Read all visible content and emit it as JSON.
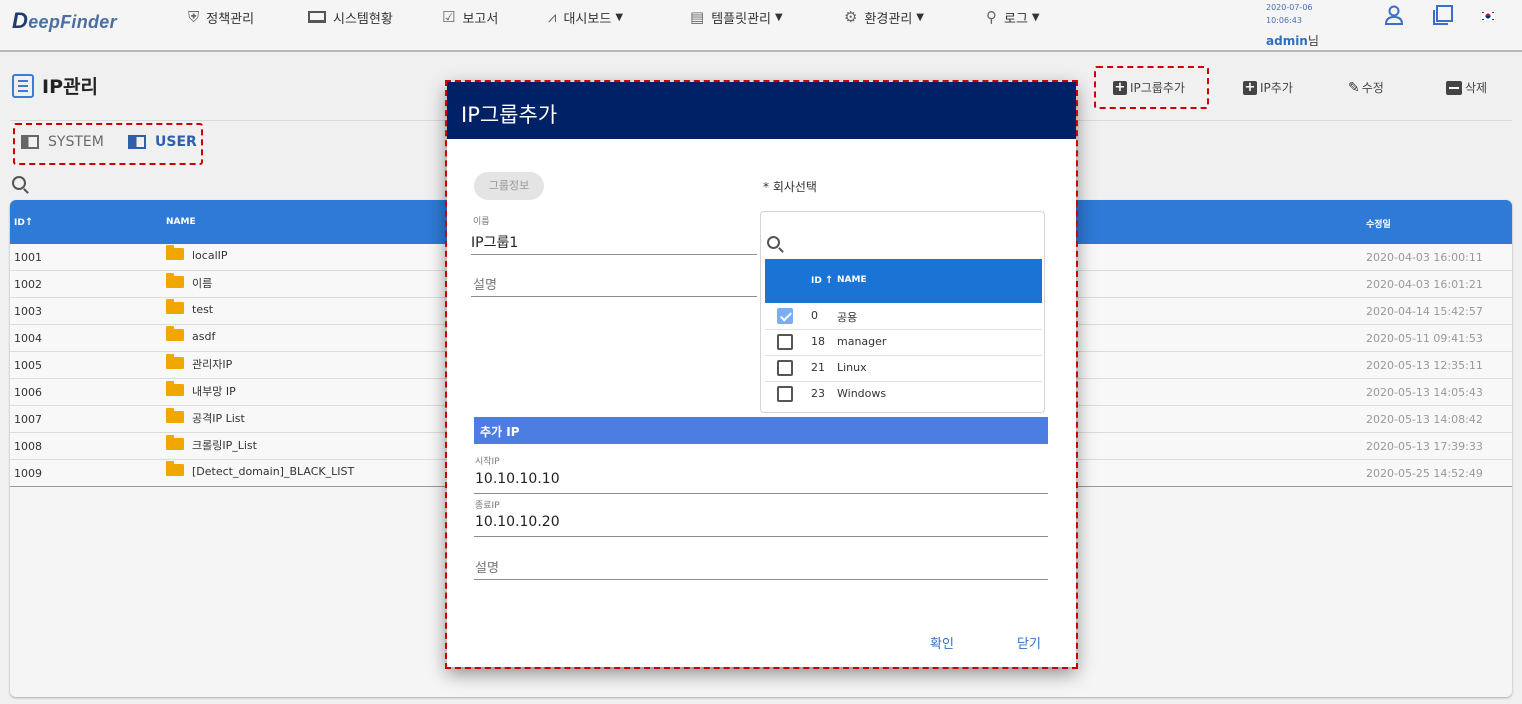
{
  "topbar": {
    "logo_first": "D",
    "logo_rest": "eepFinder",
    "nav": [
      {
        "label": "정책관리",
        "icon": "shield-icon",
        "caret": false
      },
      {
        "label": "시스템현황",
        "icon": "monitor-icon",
        "caret": false
      },
      {
        "label": "보고서",
        "icon": "clipboard-check-icon",
        "caret": false
      },
      {
        "label": "대시보드",
        "icon": "chart-line-icon",
        "caret": true
      },
      {
        "label": "템플릿관리",
        "icon": "template-icon",
        "caret": true
      },
      {
        "label": "환경관리",
        "icon": "gear-icon",
        "caret": true
      },
      {
        "label": "로그",
        "icon": "search-icon",
        "caret": true
      }
    ],
    "date": "2020-07-06",
    "time": "10:06:43",
    "user": "admin",
    "user_suffix": "님"
  },
  "page": {
    "title": "IP관리",
    "actions": {
      "add_group": "IP그룹추가",
      "add_ip": "IP추가",
      "edit": "수정",
      "delete": "삭제"
    },
    "tabs": {
      "system": "SYSTEM",
      "user": "USER"
    }
  },
  "table": {
    "headers": {
      "id": "ID",
      "sort_arrow": "↑",
      "name": "NAME",
      "modified": "수정일"
    },
    "rows": [
      {
        "id": "1001",
        "name": "localIP",
        "date": "2020-04-03 16:00:11"
      },
      {
        "id": "1002",
        "name": "이름",
        "date": "2020-04-03 16:01:21"
      },
      {
        "id": "1003",
        "name": "test",
        "date": "2020-04-14 15:42:57"
      },
      {
        "id": "1004",
        "name": "asdf",
        "date": "2020-05-11 09:41:53"
      },
      {
        "id": "1005",
        "name": "관리자IP",
        "date": "2020-05-13 12:35:11"
      },
      {
        "id": "1006",
        "name": "내부망 IP",
        "date": "2020-05-13 14:05:43"
      },
      {
        "id": "1007",
        "name": "공격IP List",
        "date": "2020-05-13 14:08:42"
      },
      {
        "id": "1008",
        "name": "크롤링IP_List",
        "date": "2020-05-13 17:39:33"
      },
      {
        "id": "1009",
        "name": "[Detect_domain]_BLACK_LIST",
        "date": "2020-05-25 14:52:49"
      }
    ]
  },
  "modal": {
    "title": "IP그룹추가",
    "group_info_pill": "그룹정보",
    "name_label": "이름",
    "name_value": "IP그룹1",
    "desc_placeholder": "설명",
    "company_label": "* 회사선택",
    "company_table": {
      "header_id": "ID",
      "sort_arrow": "↑",
      "header_name": "NAME",
      "rows": [
        {
          "id": "0",
          "name": "공용",
          "checked": true
        },
        {
          "id": "18",
          "name": "manager",
          "checked": false
        },
        {
          "id": "21",
          "name": "Linux",
          "checked": false
        },
        {
          "id": "23",
          "name": "Windows",
          "checked": false
        }
      ]
    },
    "add_ip_section": "추가 IP",
    "start_ip_label": "시작IP",
    "start_ip_value": "10.10.10.10",
    "end_ip_label": "종료IP",
    "end_ip_value": "10.10.10.20",
    "ip_desc_placeholder": "설명",
    "confirm": "확인",
    "close": "닫기"
  }
}
